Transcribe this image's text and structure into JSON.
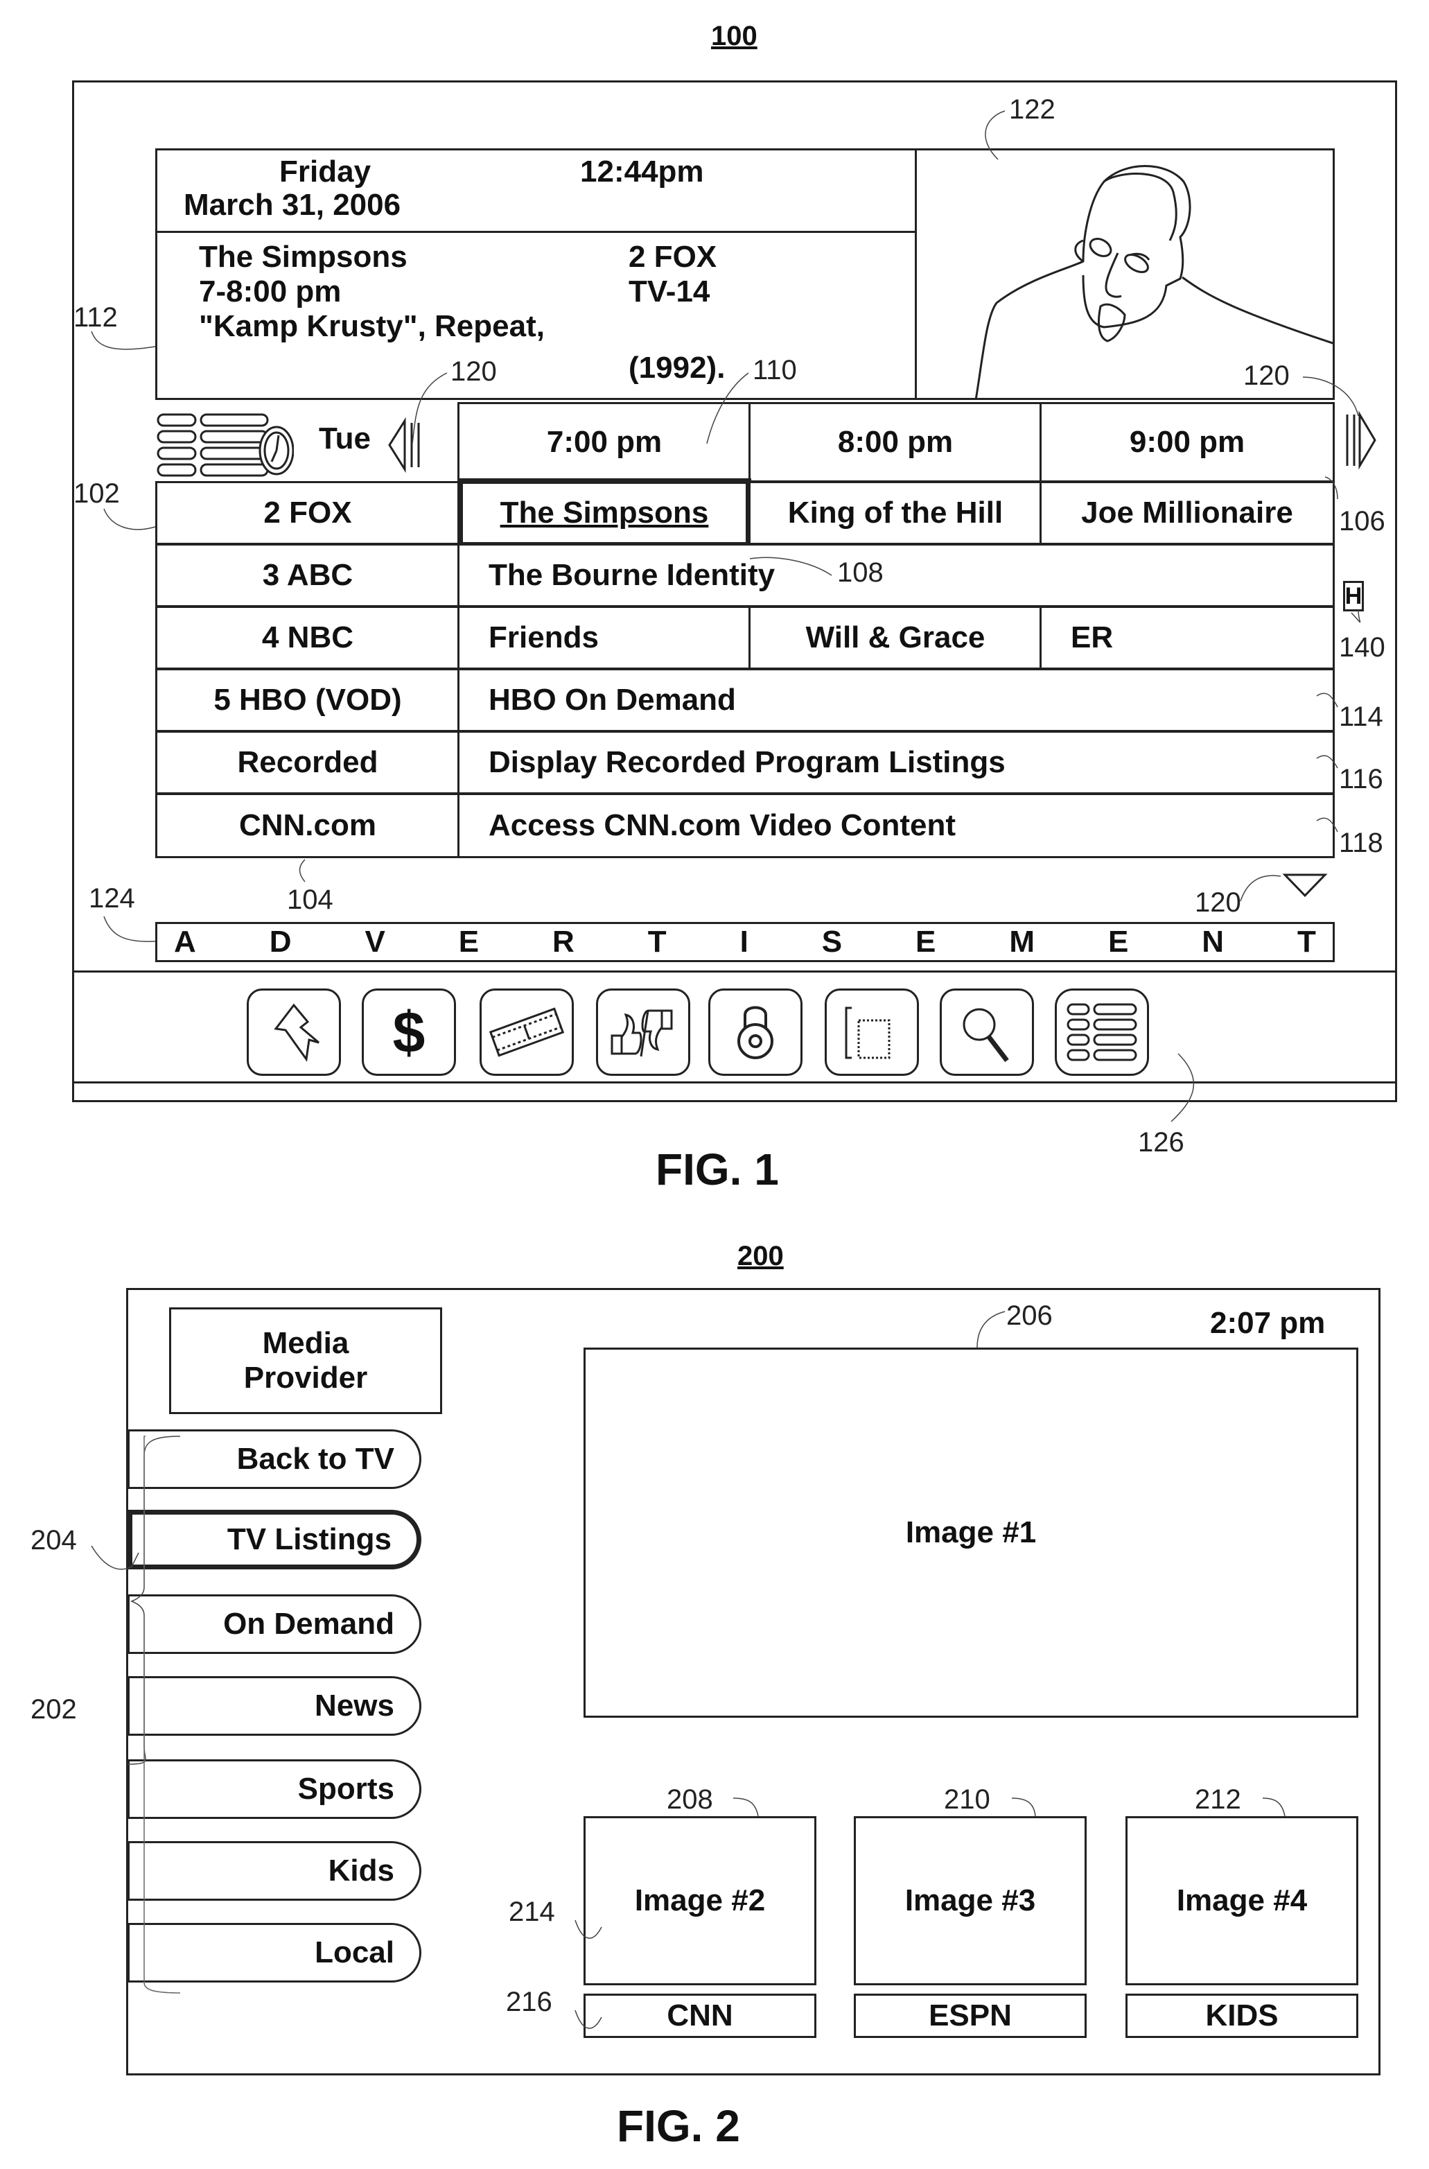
{
  "fig1": {
    "title_ref": "100",
    "caption": "FIG. 1",
    "info": {
      "day": "Friday",
      "date": "March 31, 2006",
      "time": "12:44pm",
      "program_title": "The Simpsons",
      "program_time": "7-8:00 pm",
      "episode": "\"Kamp Krusty\", Repeat,",
      "year": "(1992).",
      "channel": "2 FOX",
      "rating": "TV-14"
    },
    "grid": {
      "day_label": "Tue",
      "time_slots": [
        "7:00 pm",
        "8:00 pm",
        "9:00 pm"
      ],
      "rows": [
        {
          "channel": "2 FOX",
          "programs": [
            "The Simpsons",
            "King of the Hill",
            "Joe Millionaire"
          ]
        },
        {
          "channel": "3 ABC",
          "programs": [
            "The Bourne Identity"
          ]
        },
        {
          "channel": "4 NBC",
          "programs": [
            "Friends",
            "Will & Grace",
            "ER"
          ]
        },
        {
          "channel": "5 HBO (VOD)",
          "programs": [
            "HBO On Demand"
          ]
        },
        {
          "channel": "Recorded",
          "programs": [
            "Display Recorded Program Listings"
          ]
        },
        {
          "channel": "CNN.com",
          "programs": [
            "Access CNN.com Video Content"
          ]
        }
      ],
      "selected_program": "The Simpsons",
      "h_badge": "H"
    },
    "advertisement": [
      "A",
      "D",
      "V",
      "E",
      "R",
      "T",
      "I",
      "S",
      "E",
      "M",
      "E",
      "N",
      "T"
    ],
    "toolbar_icons": [
      "back-arrow-icon",
      "dollar-icon",
      "film-strip-icon",
      "thumbs-up-down-icon",
      "lock-icon",
      "window-icon",
      "search-icon",
      "guide-grid-icon"
    ],
    "refs": {
      "r102": "102",
      "r104": "104",
      "r106": "106",
      "r108": "108",
      "r110": "110",
      "r112": "112",
      "r114": "114",
      "r116": "116",
      "r118": "118",
      "r120": "120",
      "r122": "122",
      "r124": "124",
      "r126": "126",
      "r140": "140"
    }
  },
  "fig2": {
    "title_ref": "200",
    "caption": "FIG. 2",
    "time": "2:07 pm",
    "provider": [
      "Media",
      "Provider"
    ],
    "nav": [
      {
        "label": "Back to TV",
        "selected": false
      },
      {
        "label": "TV Listings",
        "selected": true
      },
      {
        "label": "On Demand",
        "selected": false
      },
      {
        "label": "News",
        "selected": false
      },
      {
        "label": "Sports",
        "selected": false
      },
      {
        "label": "Kids",
        "selected": false
      },
      {
        "label": "Local",
        "selected": false
      }
    ],
    "main_image": "Image #1",
    "tiles": [
      {
        "image": "Image #2",
        "label": "CNN"
      },
      {
        "image": "Image #3",
        "label": "ESPN"
      },
      {
        "image": "Image #4",
        "label": "KIDS"
      }
    ],
    "refs": {
      "r202": "202",
      "r204": "204",
      "r206": "206",
      "r208": "208",
      "r210": "210",
      "r212": "212",
      "r214": "214",
      "r216": "216"
    }
  }
}
